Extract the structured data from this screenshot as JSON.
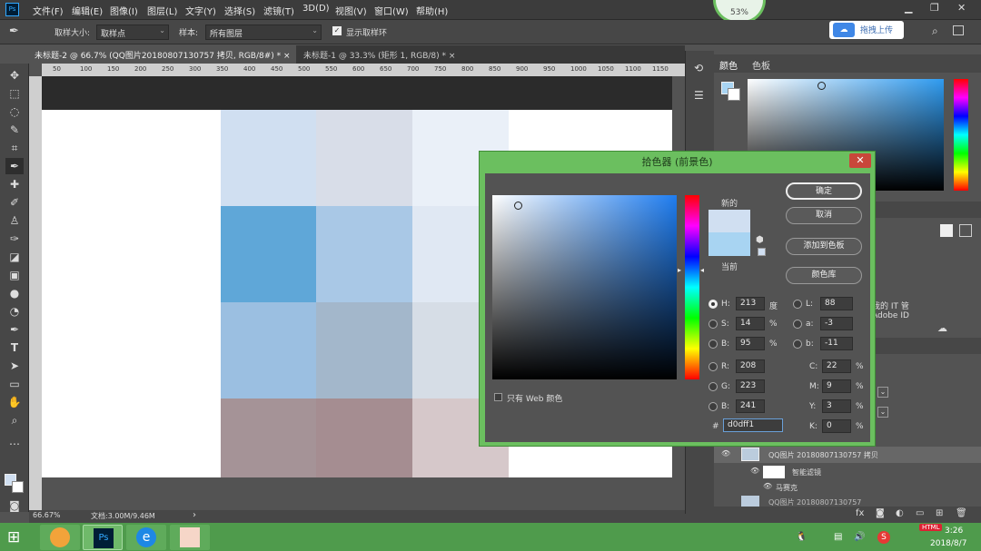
{
  "menubar": {
    "logo": "Ps",
    "items": [
      "文件(F)",
      "编辑(E)",
      "图像(I)",
      "图层(L)",
      "文字(Y)",
      "选择(S)",
      "滤镜(T)",
      "3D(D)",
      "视图(V)",
      "窗口(W)",
      "帮助(H)"
    ],
    "window_controls": [
      "▁",
      "❐",
      "✕"
    ]
  },
  "percent_badge": "53%",
  "options": {
    "sample_size_label": "取样大小:",
    "sample_size_value": "取样点",
    "sample_label": "样本:",
    "sample_value": "所有图层",
    "show_ring_label": "显示取样环",
    "cloud_label": "拖拽上传"
  },
  "tabs": [
    "未标题-2 @ 66.7% (QQ图片20180807130757 拷贝, RGB/8#) *",
    "未标题-1 @ 33.3% (矩形 1, RGB/8) *"
  ],
  "ruler_ticks": [
    "50",
    "100",
    "150",
    "200",
    "250",
    "300",
    "350",
    "400",
    "450",
    "500",
    "550",
    "600",
    "650",
    "700",
    "750",
    "800",
    "850",
    "900",
    "950",
    "1000",
    "1050",
    "1100",
    "1150"
  ],
  "status": {
    "zoom": "66.67%",
    "doc": "文档:3.00M/9.46M"
  },
  "right_panel": {
    "tab_color": "颜色",
    "tab_swatches": "色板",
    "partial_text_1": "我的 IT 管",
    "partial_text_2": "Adobe ID"
  },
  "layers": {
    "row1": "QQ图片 20180807130757 拷贝",
    "row2": "智能滤镜",
    "row3": "马赛克",
    "row4": "QQ图片 20180807130757"
  },
  "dialog": {
    "title": "拾色器 (前景色)",
    "close": "✕",
    "new_label": "新的",
    "current_label": "当前",
    "new_color": "#d0dff1",
    "current_color": "#a8d4f2",
    "web_only_label": "只有 Web 颜色",
    "buttons": {
      "ok": "确定",
      "cancel": "取消",
      "add_swatch": "添加到色板",
      "libraries": "颜色库"
    },
    "hsb": {
      "h_label": "H:",
      "h": "213",
      "h_unit": "度",
      "s_label": "S:",
      "s": "14",
      "s_unit": "%",
      "b_label": "B:",
      "b": "95",
      "b_unit": "%"
    },
    "rgb": {
      "r_label": "R:",
      "r": "208",
      "g_label": "G:",
      "g": "223",
      "b_label": "B:",
      "b": "241"
    },
    "lab": {
      "l_label": "L:",
      "l": "88",
      "a_label": "a:",
      "a": "-3",
      "b_label": "b:",
      "b": "-11"
    },
    "cmyk": {
      "c_label": "C:",
      "c": "22",
      "m_label": "M:",
      "m": "9",
      "y_label": "Y:",
      "y": "3",
      "k_label": "K:",
      "k": "0",
      "unit": "%"
    },
    "hex_label": "#",
    "hex": "d0dff1"
  },
  "clock": {
    "time": "3:26",
    "date": "2018/8/7"
  },
  "tray_badge": "HTML"
}
